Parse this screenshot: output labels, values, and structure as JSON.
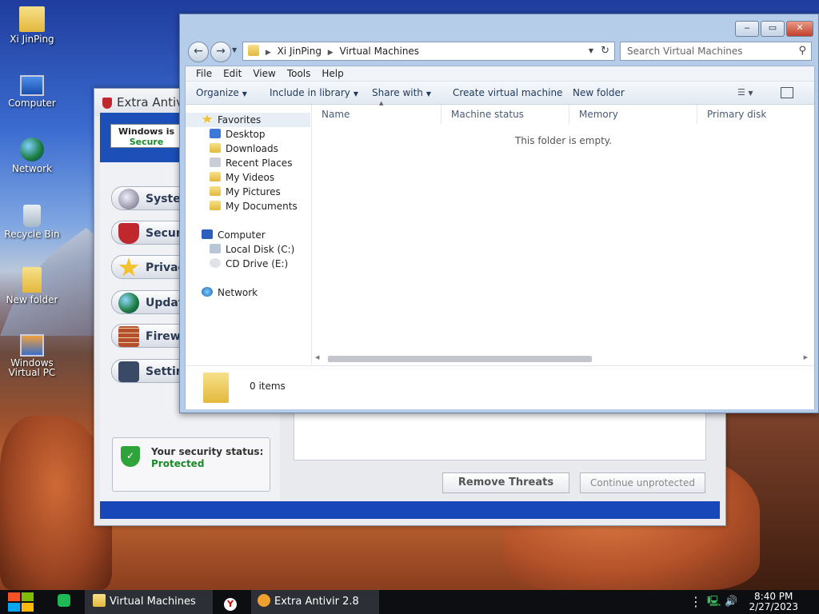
{
  "desktop": {
    "icons": [
      {
        "label": "Xi JinPing",
        "icon": "user-folder-icon"
      },
      {
        "label": "Computer",
        "icon": "computer-icon"
      },
      {
        "label": "Network",
        "icon": "network-icon"
      },
      {
        "label": "Recycle Bin",
        "icon": "recycle-bin-icon"
      },
      {
        "label": "New folder",
        "icon": "folder-icon"
      },
      {
        "label": "Windows Virtual PC",
        "icon": "virtual-pc-icon"
      }
    ]
  },
  "antivirus": {
    "title": "Extra Antiv",
    "secure_line1": "Windows is",
    "secure_line2": "Secure",
    "nav": [
      "Syste",
      "Securi",
      "Privac",
      "Update",
      "Firew",
      "Settin"
    ],
    "status_label": "Your security status:",
    "status_value": "Protected",
    "remove_button": "Remove Threats",
    "continue_button": "Continue unprotected"
  },
  "explorer": {
    "caption": {
      "minimize": "‒",
      "maximize": "▭",
      "close": "✕"
    },
    "breadcrumb": [
      "Xi JinPing",
      "Virtual Machines"
    ],
    "search_placeholder": "Search Virtual Machines",
    "menu": [
      "File",
      "Edit",
      "View",
      "Tools",
      "Help"
    ],
    "toolbar": {
      "organize": "Organize",
      "include_in_library": "Include in library",
      "share_with": "Share with",
      "create_vm": "Create virtual machine",
      "new_folder": "New folder"
    },
    "nav": {
      "favorites": "Favorites",
      "favorites_items": [
        "Desktop",
        "Downloads",
        "Recent Places",
        "My Videos",
        "My Pictures",
        "My Documents"
      ],
      "computer": "Computer",
      "computer_items": [
        "Local Disk (C:)",
        "CD Drive (E:)"
      ],
      "network": "Network"
    },
    "columns": [
      "Name",
      "Machine status",
      "Memory",
      "Primary disk"
    ],
    "empty_message": "This folder is empty.",
    "item_count": "0 items"
  },
  "taskbar": {
    "items": [
      "Virtual Machines",
      "Extra Antivir 2.8"
    ],
    "time": "8:40 PM",
    "date": "2/27/2023"
  },
  "colors": {
    "accent_blue": "#1747b8",
    "protected_green": "#1a8a2a",
    "close_red": "#c2402a"
  }
}
